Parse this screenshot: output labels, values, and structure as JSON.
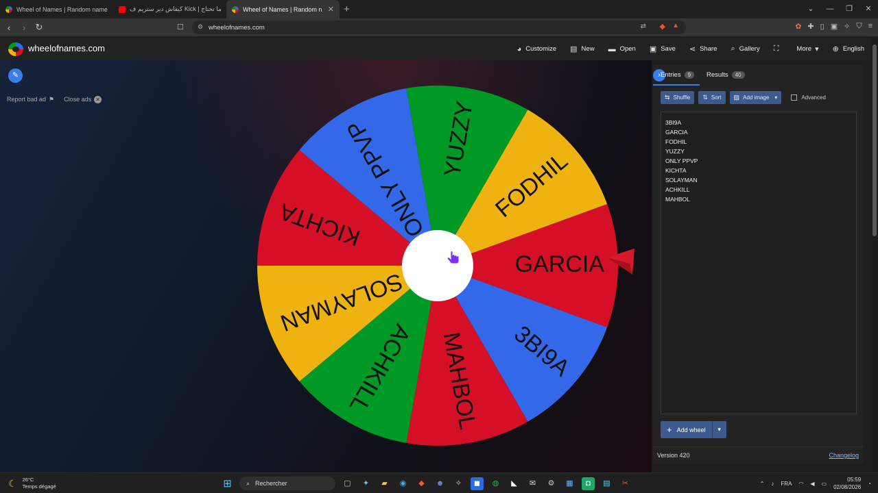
{
  "browser": {
    "tabs": [
      {
        "label": "Wheel of Names | Random name pick",
        "fav_color": "#4285f4",
        "active": false
      },
      {
        "label": "كيفاش دير ستريم ف Kick | كل ما تحتاج",
        "fav_color": "#ff0000",
        "active": false
      },
      {
        "label": "Wheel of Names | Random n",
        "fav_color": "#4285f4",
        "active": true
      }
    ],
    "new_tab": "+",
    "url": "wheelofnames.com"
  },
  "site": {
    "name": "wheelofnames.com",
    "menu": [
      {
        "label": "Customize",
        "icon": "palette-icon"
      },
      {
        "label": "New",
        "icon": "file-icon"
      },
      {
        "label": "Open",
        "icon": "folder-icon"
      },
      {
        "label": "Save",
        "icon": "save-icon"
      },
      {
        "label": "Share",
        "icon": "share-icon"
      },
      {
        "label": "Gallery",
        "icon": "search-icon"
      },
      {
        "label": "",
        "icon": "fullscreen-icon"
      },
      {
        "label": "More",
        "icon": "chevron-down-icon"
      },
      {
        "label": "English",
        "icon": "globe-icon"
      }
    ]
  },
  "ads": {
    "report_label": "Report bad ad",
    "close_label": "Close ads"
  },
  "wheel": {
    "segments": [
      {
        "label": "GARCIA",
        "color": "#d50f25"
      },
      {
        "label": "3BI9A",
        "color": "#3369e8"
      },
      {
        "label": "MAHBOL",
        "color": "#d50f25"
      },
      {
        "label": "ACHKILL",
        "color": "#009925"
      },
      {
        "label": "SOLAYMAN",
        "color": "#eeb211"
      },
      {
        "label": "KICHTA",
        "color": "#d50f25"
      },
      {
        "label": "ONLY PPVP",
        "color": "#3369e8"
      },
      {
        "label": "YUZZY",
        "color": "#009925"
      },
      {
        "label": "FODHIL",
        "color": "#eeb211"
      }
    ]
  },
  "panel": {
    "entries_tab": "Entries",
    "entries_count": "9",
    "results_tab": "Results",
    "results_count": "40",
    "shuffle": "Shuffle",
    "sort": "Sort",
    "add_image": "Add image",
    "advanced": "Advanced",
    "entries": [
      "3BI9A",
      "GARCIA",
      "FODHIL",
      "YUZZY",
      "ONLY PPVP",
      "KICHTA",
      "SOLAYMAN",
      "ACHKILL",
      "MAHBOL"
    ],
    "add_wheel": "Add wheel",
    "version": "Version 420",
    "changelog": "Changelog"
  },
  "taskbar": {
    "temp": "26°C",
    "weather": "Temps dégagé",
    "search": "Rechercher",
    "lang": "FRA",
    "time": "05:59",
    "date": "02/08/2026"
  }
}
